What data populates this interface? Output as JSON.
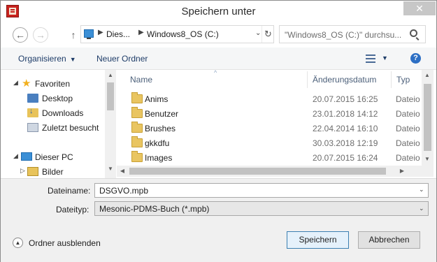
{
  "window": {
    "title": "Speichern unter",
    "close_glyph": "✕"
  },
  "navigation": {
    "back_glyph": "←",
    "forward_glyph": "→",
    "up_glyph": "↑"
  },
  "addressbar": {
    "crumbs": [
      "Dies...",
      "Windows8_OS (C:)"
    ],
    "separator_glyph": "▶",
    "dropdown_glyph": "⌄",
    "refresh_glyph": "↻"
  },
  "search": {
    "placeholder": "\"Windows8_OS (C:)\" durchsu..."
  },
  "toolbar": {
    "organize_label": "Organisieren",
    "new_folder_label": "Neuer Ordner",
    "caret_glyph": "▼",
    "help_glyph": "?"
  },
  "navpane": {
    "expand_glyph": "◢",
    "collapsed_glyph": "▷",
    "favorites": {
      "label": "Favoriten",
      "items": [
        "Desktop",
        "Downloads",
        "Zuletzt besucht"
      ]
    },
    "this_pc": {
      "label": "Dieser PC",
      "items": [
        "Bilder"
      ]
    }
  },
  "filelist": {
    "columns": {
      "name": "Name",
      "date": "Änderungsdatum",
      "type": "Typ"
    },
    "sort_glyph": "^",
    "rows": [
      {
        "name": "Anims",
        "date": "20.07.2015 16:25",
        "type": "Dateio"
      },
      {
        "name": "Benutzer",
        "date": "23.01.2018 14:12",
        "type": "Dateio"
      },
      {
        "name": "Brushes",
        "date": "22.04.2014 16:10",
        "type": "Dateio"
      },
      {
        "name": "gkkdfu",
        "date": "30.03.2018 12:19",
        "type": "Dateio"
      },
      {
        "name": "Images",
        "date": "20.07.2015 16:24",
        "type": "Dateio"
      }
    ],
    "scroll_up": "▲",
    "scroll_down": "▼",
    "scroll_left": "◀",
    "scroll_right": "▶"
  },
  "form": {
    "filename_label": "Dateiname:",
    "filename_value": "DSGVO.mpb",
    "filetype_label": "Dateityp:",
    "filetype_value": "Mesonic-PDMS-Buch (*.mpb)",
    "dropdown_glyph": "⌄"
  },
  "footer": {
    "hide_folders_label": "Ordner ausblenden",
    "hide_glyph": "▲",
    "save_label": "Speichern",
    "cancel_label": "Abbrechen"
  },
  "colors": {
    "accent": "#3c7fb1",
    "toolbar_text": "#1e3c68",
    "folder": "#e9c561"
  }
}
